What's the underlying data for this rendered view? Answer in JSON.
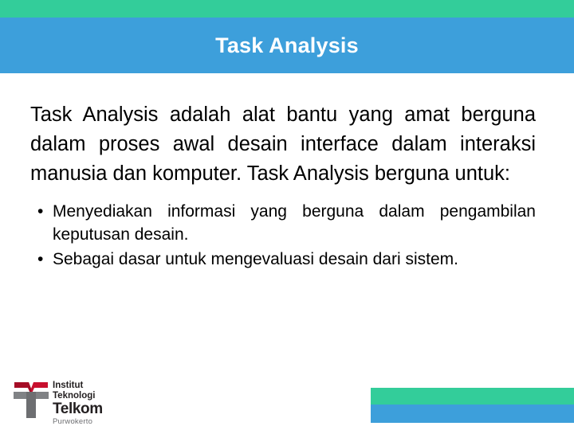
{
  "header": {
    "title": "Task Analysis",
    "green_color": "#33cd9a",
    "blue_color": "#3d9fdb"
  },
  "body": {
    "paragraph": "Task Analysis adalah alat bantu yang amat berguna dalam proses awal desain interface dalam interaksi manusia dan komputer.  Task Analysis berguna untuk:",
    "bullet_marker": "•",
    "bullets": [
      "Menyediakan informasi yang berguna dalam pengambilan keputusan desain.",
      "Sebagai dasar untuk mengevaluasi desain dari sistem."
    ]
  },
  "logo": {
    "line1": "Institut",
    "line2": "Teknologi",
    "line3": "Telkom",
    "line4": "Purwokerto",
    "mark_red": "#c8102e",
    "mark_gray": "#808285"
  },
  "footer": {
    "green_color": "#33cd9a",
    "blue_color": "#3d9fdb"
  }
}
